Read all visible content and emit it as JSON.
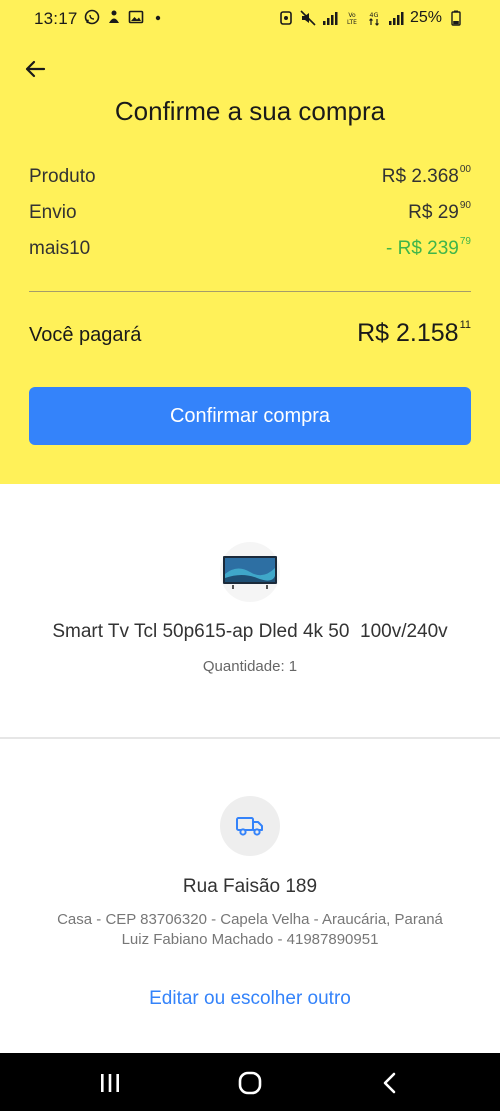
{
  "status_bar": {
    "time": "13:17",
    "battery": "25%",
    "left_icons": [
      "whatsapp-icon",
      "accessibility-icon",
      "gallery-icon",
      "dot-icon"
    ],
    "right_icons": [
      "alarm-icon",
      "mute-icon",
      "signal-icon",
      "volte-icon",
      "data-4g-icon",
      "signal-icon-2",
      "battery-icon"
    ]
  },
  "header": {
    "title": "Confirme a sua compra"
  },
  "summary": {
    "produto_label": "Produto",
    "produto_value": "R$ 2.368",
    "produto_cents": "00",
    "envio_label": "Envio",
    "envio_value": "R$ 29",
    "envio_cents": "90",
    "desconto_label": "mais10",
    "desconto_value": "- R$ 239",
    "desconto_cents": "79",
    "total_label": "Você pagará",
    "total_value": "R$ 2.158",
    "total_cents": "11"
  },
  "confirm_button": "Confirmar compra",
  "product": {
    "name": "Smart Tv Tcl 50p615-ap Dled 4k 50  100v/240v",
    "quantity": "Quantidade: 1"
  },
  "address": {
    "street": "Rua Faisão 189",
    "line1": "Casa - CEP 83706320 - Capela Velha - Araucária, Paraná",
    "line2": "Luiz Fabiano Machado - 41987890951",
    "edit_link": "Editar ou escolher outro"
  },
  "colors": {
    "header_background": "#fff159",
    "primary": "#3483fa",
    "discount": "#3fb54a"
  }
}
